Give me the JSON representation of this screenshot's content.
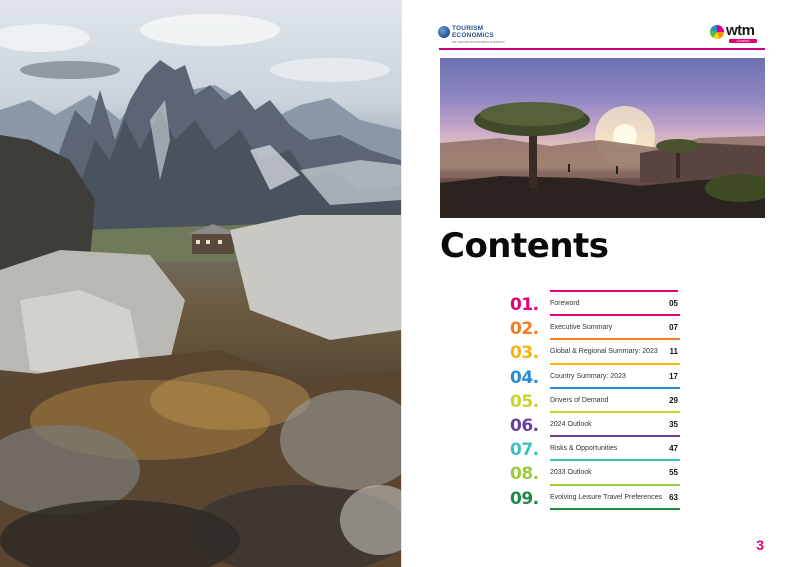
{
  "logos": {
    "tourism_economics": {
      "line1": "TOURISM",
      "line2": "ECONOMICS",
      "tagline": "AN OXFORD ECONOMICS COMPANY"
    },
    "wtm": {
      "name": "wtm",
      "badge": "LONDON"
    }
  },
  "title": "Contents",
  "toc": [
    {
      "num": "01.",
      "label": "Foreword",
      "page": "05",
      "color": "#e4007c"
    },
    {
      "num": "02.",
      "label": "Executive Summary",
      "page": "07",
      "color": "#f47b20"
    },
    {
      "num": "03.",
      "label": "Global & Regional Summary: 2023",
      "page": "11",
      "color": "#f7b512"
    },
    {
      "num": "04.",
      "label": "Country Summary: 2023",
      "page": "17",
      "color": "#2a8dd4"
    },
    {
      "num": "05.",
      "label": "Drivers of Demand",
      "page": "29",
      "color": "#c6d42c"
    },
    {
      "num": "06.",
      "label": "2024 Outlook",
      "page": "35",
      "color": "#6a3f9a"
    },
    {
      "num": "07.",
      "label": "Risks & Opportunities",
      "page": "47",
      "color": "#3cc0c0"
    },
    {
      "num": "08.",
      "label": "2033 Outlook",
      "page": "55",
      "color": "#9ccb3b"
    },
    {
      "num": "09.",
      "label": "Evolving Leisure Travel Preferences",
      "page": "63",
      "color": "#1e8a46"
    }
  ],
  "page_number": "3",
  "colors": {
    "accent": "#e4007c",
    "header_rule": "#c8007a"
  }
}
